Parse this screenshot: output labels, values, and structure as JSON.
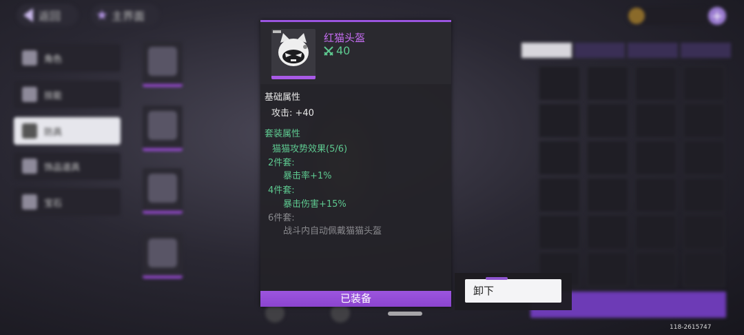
{
  "topbar": {
    "back_label": "返回",
    "title": "主界面"
  },
  "sidebar": {
    "items": [
      {
        "label": "角色",
        "active": false
      },
      {
        "label": "技能",
        "active": false
      },
      {
        "label": "防具",
        "active": true
      },
      {
        "label": "饰品道具",
        "active": false
      },
      {
        "label": "宝石",
        "active": false
      }
    ]
  },
  "tooltip": {
    "item_name": "红猫头盔",
    "attack_value": "40",
    "base_section_title": "基础属性",
    "base_attr": "攻击:  +40",
    "set_section_title": "套装属性",
    "set_name": "猫猫攻势效果(5/6)",
    "set2_label": "2件套:",
    "set2_effect": "暴击率+1%",
    "set4_label": "4件套:",
    "set4_effect": "暴击伤害+15%",
    "set6_label": "6件套:",
    "set6_effect": "战斗内自动佩戴猫猫头盔",
    "equipped_label": "已装备"
  },
  "actions": {
    "unequip_label": "卸下"
  },
  "footer": {
    "version": "118-2615747"
  },
  "colors": {
    "accent": "#9b55e0",
    "item_name": "#c56df2",
    "set_green": "#5ec990"
  },
  "icons": {
    "item": "cat-helmet-icon",
    "attack": "crossed-swords-icon",
    "back": "back-arrow-icon",
    "currency": "coin-icon"
  }
}
